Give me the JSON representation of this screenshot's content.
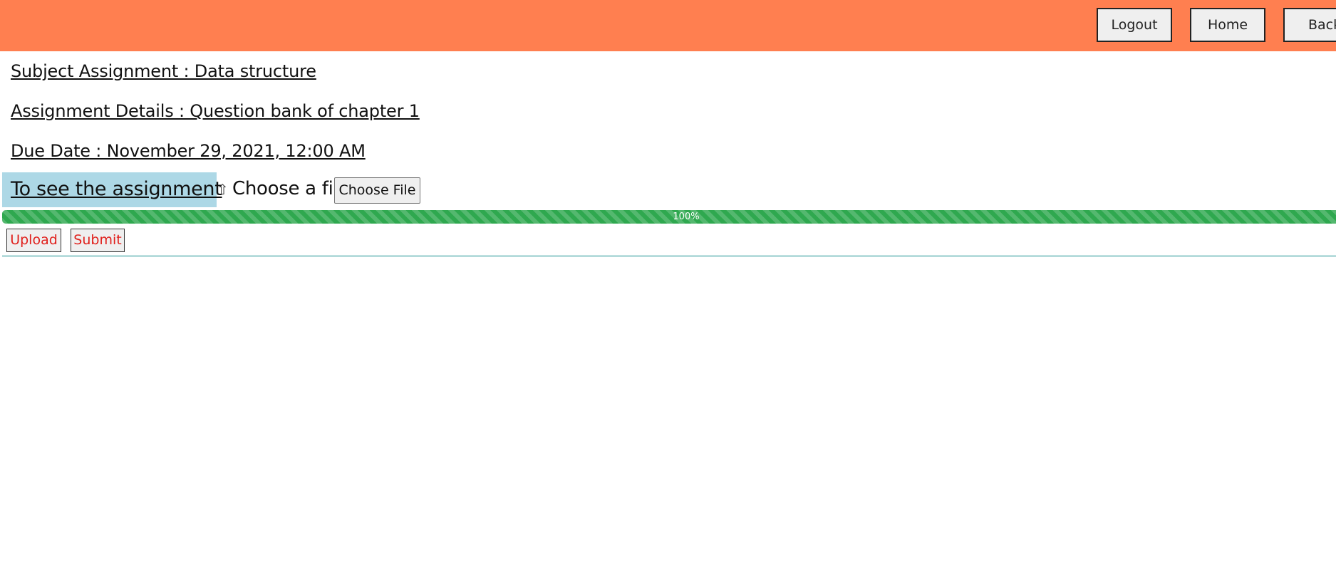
{
  "header": {
    "logout_label": "Logout",
    "home_label": "Home",
    "back_label": "Back"
  },
  "assignment": {
    "subject_line": "Subject Assignment : Data structure",
    "details_line": "Assignment Details : Question bank of chapter 1",
    "due_line": "Due Date : November 29, 2021, 12:00 AM",
    "see_link": "To see the assignment"
  },
  "file_picker": {
    "arrow_icon": "upload-arrow-icon",
    "arrow_glyph": "⇧",
    "label": "Choose a file",
    "button_label": "Choose File"
  },
  "progress": {
    "value_percent": 100,
    "label": "100%"
  },
  "actions": {
    "upload_label": "Upload",
    "submit_label": "Submit"
  },
  "colors": {
    "header_bg": "#ff7f50",
    "link_highlight_bg": "#add8e6",
    "progress_green": "#2fa84f",
    "action_text": "#e0201c",
    "divider": "#0e8a8a"
  }
}
